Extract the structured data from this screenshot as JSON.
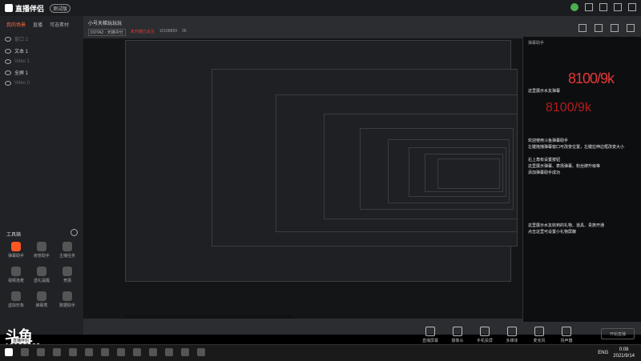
{
  "app": {
    "name": "直播伴侣",
    "beta": "测试版"
  },
  "sidebar": {
    "tabs": [
      "我的场景",
      "直播",
      "可选素材"
    ],
    "items": [
      {
        "label": "窗口 2",
        "state": "dim"
      },
      {
        "label": "文本 1",
        "state": "on"
      },
      {
        "label": "Vdeo 1",
        "state": "dim"
      },
      {
        "label": "全屏 1",
        "state": "on"
      },
      {
        "label": "Vdeo 0",
        "state": "dim"
      }
    ],
    "toolbox_title": "工具箱",
    "tools": [
      {
        "label": "弹幕助手",
        "active": true
      },
      {
        "label": "房管助手",
        "active": false
      },
      {
        "label": "主播任务",
        "active": false
      },
      {
        "label": "视频连麦",
        "active": false
      },
      {
        "label": "送礼提醒",
        "active": false
      },
      {
        "label": "竞猜",
        "active": false
      },
      {
        "label": "虚拟形象",
        "active": false
      },
      {
        "label": "弹幕秀",
        "active": false
      },
      {
        "label": "数据助手",
        "active": false
      }
    ],
    "brand_logo": "斗鱼",
    "brand_sub": "直播伴侣"
  },
  "header": {
    "room_title": "小号天梯玩玩玩",
    "category": "DOTA2 · 天梯冲分",
    "status": "未开播已关注",
    "room_id_label": "10108869",
    "extra": "36"
  },
  "chat": {
    "header": "弹幕助手",
    "count_big": "8100/9k",
    "count_echo": "8100/9k",
    "lines": [
      "这里展示水友弹幕",
      "欢迎使用斗鱼弹幕助手",
      "左键拖拽弹幕窗口可改变位置，左键拉伸边框改变大小",
      "右上角有设置按钮",
      "这里展示弹幕、表扬弹幕、粉丝牌升级等",
      "添加弹幕助手成功",
      "这里展示水友收到的礼物、道具、贵族开通",
      "点击这里可设置小礼物屏蔽"
    ]
  },
  "bottom_tools": [
    "直播屏幕",
    "摄像头",
    "手机投屏",
    "多媒体",
    "麦克风",
    "扬声器"
  ],
  "live_button": "开始直播",
  "room_id": "10108869",
  "taskbar": {
    "lang": "ENG",
    "time": "0:08",
    "date": "2021/9/14"
  }
}
